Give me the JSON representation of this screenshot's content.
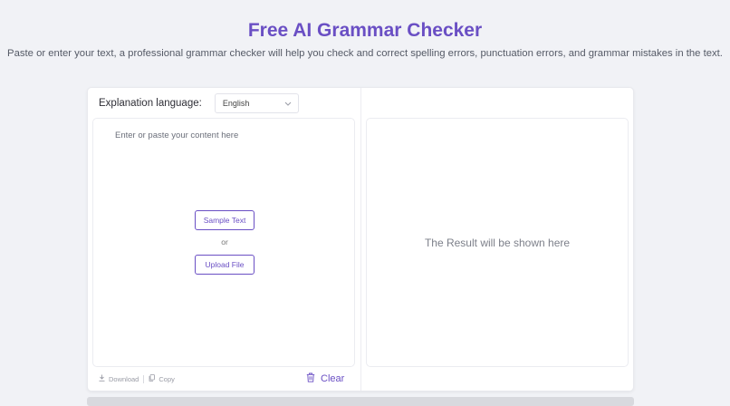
{
  "header": {
    "title": "Free AI Grammar Checker",
    "subtitle": "Paste or enter your text, a professional grammar checker will help you check and correct spelling errors, punctuation errors, and grammar mistakes in the text."
  },
  "editor": {
    "language_label": "Explanation language:",
    "language_value": "English",
    "placeholder": "Enter or paste your content here",
    "sample_button": "Sample Text",
    "or_text": "or",
    "upload_button": "Upload File"
  },
  "footer": {
    "download_label": "Download",
    "copy_label": "Copy",
    "clear_label": "Clear"
  },
  "result": {
    "placeholder": "The Result will be shown here"
  },
  "colors": {
    "accent": "#6a4fc4",
    "background": "#f1f2f6"
  },
  "icons": [
    "chevron-down-icon",
    "download-icon",
    "copy-icon",
    "trash-icon"
  ]
}
